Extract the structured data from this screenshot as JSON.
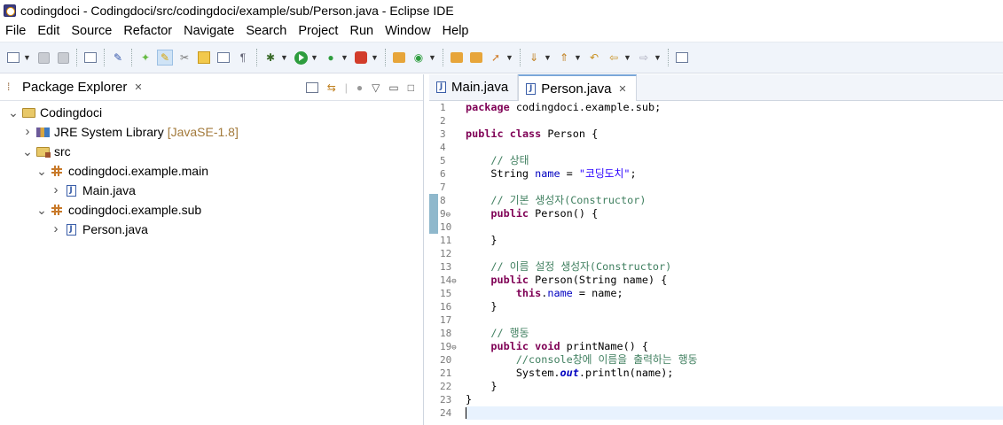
{
  "window": {
    "title": "codingdoci - Codingdoci/src/codingdoci/example/sub/Person.java - Eclipse IDE"
  },
  "menu": [
    "File",
    "Edit",
    "Source",
    "Refactor",
    "Navigate",
    "Search",
    "Project",
    "Run",
    "Window",
    "Help"
  ],
  "package_explorer": {
    "title": "Package Explorer",
    "tree": [
      {
        "label": "Codingdoci",
        "kind": "project",
        "depth": 0,
        "twisty": "expanded"
      },
      {
        "label": "JRE System Library",
        "tag": "[JavaSE-1.8]",
        "kind": "library",
        "depth": 1,
        "twisty": "collapsed"
      },
      {
        "label": "src",
        "kind": "src",
        "depth": 1,
        "twisty": "expanded"
      },
      {
        "label": "codingdoci.example.main",
        "kind": "package",
        "depth": 2,
        "twisty": "expanded"
      },
      {
        "label": "Main.java",
        "kind": "java",
        "depth": 3,
        "twisty": "collapsed"
      },
      {
        "label": "codingdoci.example.sub",
        "kind": "package",
        "depth": 2,
        "twisty": "expanded"
      },
      {
        "label": "Person.java",
        "kind": "java",
        "depth": 3,
        "twisty": "collapsed"
      }
    ]
  },
  "editor": {
    "tabs": [
      {
        "label": "Main.java",
        "active": false
      },
      {
        "label": "Person.java",
        "active": true
      }
    ],
    "current_line": 24,
    "folded_lines": [
      9,
      14,
      19
    ],
    "lines": [
      [
        {
          "t": "package",
          "c": "kw"
        },
        {
          "t": " codingdoci.example.sub;"
        }
      ],
      [],
      [
        {
          "t": "public",
          "c": "kw"
        },
        {
          "t": " "
        },
        {
          "t": "class",
          "c": "kw"
        },
        {
          "t": " Person {"
        }
      ],
      [],
      [
        {
          "t": "    "
        },
        {
          "t": "// 상태",
          "c": "cmt"
        }
      ],
      [
        {
          "t": "    String "
        },
        {
          "t": "name",
          "c": "fld"
        },
        {
          "t": " = "
        },
        {
          "t": "\"코딩도치\"",
          "c": "str"
        },
        {
          "t": ";"
        }
      ],
      [],
      [
        {
          "t": "    "
        },
        {
          "t": "// 기본 생성자(Constructor)",
          "c": "cmt"
        }
      ],
      [
        {
          "t": "    "
        },
        {
          "t": "public",
          "c": "kw"
        },
        {
          "t": " Person() {"
        }
      ],
      [],
      [
        {
          "t": "    }"
        }
      ],
      [],
      [
        {
          "t": "    "
        },
        {
          "t": "// 이름 설정 생성자(Constructor)",
          "c": "cmt"
        }
      ],
      [
        {
          "t": "    "
        },
        {
          "t": "public",
          "c": "kw"
        },
        {
          "t": " Person(String name) {"
        }
      ],
      [
        {
          "t": "        "
        },
        {
          "t": "this",
          "c": "kw"
        },
        {
          "t": "."
        },
        {
          "t": "name",
          "c": "fld"
        },
        {
          "t": " = name;"
        }
      ],
      [
        {
          "t": "    }"
        }
      ],
      [],
      [
        {
          "t": "    "
        },
        {
          "t": "// 행동",
          "c": "cmt"
        }
      ],
      [
        {
          "t": "    "
        },
        {
          "t": "public",
          "c": "kw"
        },
        {
          "t": " "
        },
        {
          "t": "void",
          "c": "kw"
        },
        {
          "t": " printName() {"
        }
      ],
      [
        {
          "t": "        "
        },
        {
          "t": "//console창에 이름을 출력하는 행동",
          "c": "cmt"
        }
      ],
      [
        {
          "t": "        System."
        },
        {
          "t": "out",
          "c": "sfld"
        },
        {
          "t": ".println(name);"
        }
      ],
      [
        {
          "t": "    }"
        }
      ],
      [
        {
          "t": "}"
        }
      ],
      []
    ]
  }
}
